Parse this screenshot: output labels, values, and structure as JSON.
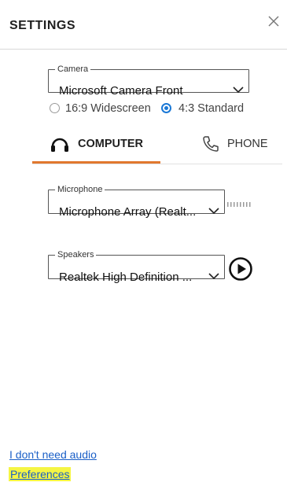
{
  "header": {
    "title": "SETTINGS",
    "close_icon": "close-icon"
  },
  "camera": {
    "legend": "Camera",
    "selected": "Microsoft Camera Front",
    "aspect_options": [
      {
        "label": "16:9 Widescreen",
        "checked": false
      },
      {
        "label": "4:3 Standard",
        "checked": true
      }
    ]
  },
  "tabs": [
    {
      "label": "COMPUTER",
      "icon": "headset-icon",
      "active": true
    },
    {
      "label": "PHONE",
      "icon": "phone-icon",
      "active": false
    }
  ],
  "microphone": {
    "legend": "Microphone",
    "selected": "Microphone Array (Realt..."
  },
  "speakers": {
    "legend": "Speakers",
    "selected": "Realtek High Definition ..."
  },
  "links": {
    "no_audio": "I don't need audio",
    "preferences": "Preferences"
  },
  "colors": {
    "accent": "#e1782e",
    "radio_selected": "#1a78d6",
    "link": "#1a5fc7",
    "highlight": "#f5f544"
  }
}
